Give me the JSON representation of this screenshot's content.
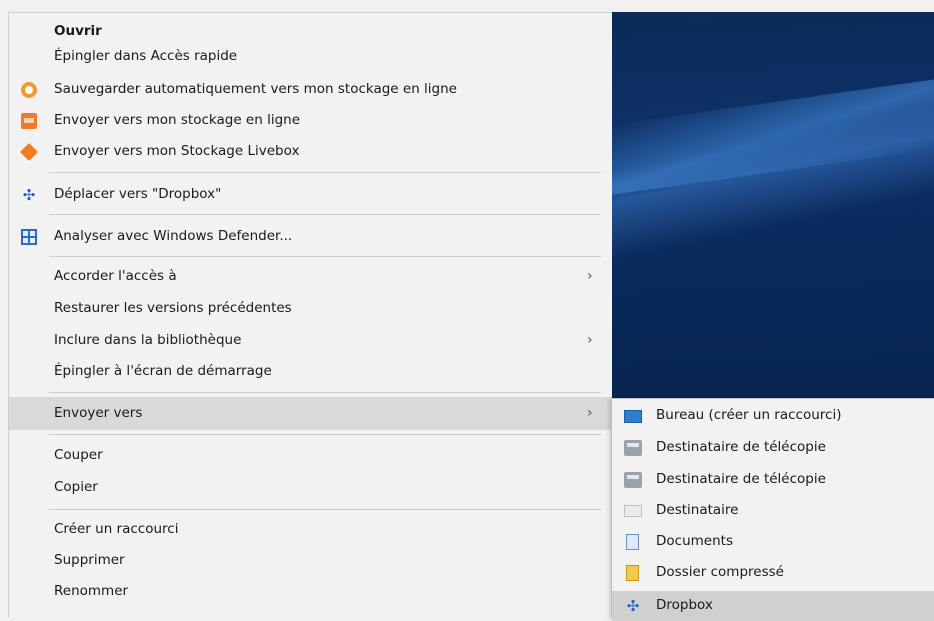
{
  "menu": {
    "items": [
      {
        "label": "Ouvrir",
        "icon": null
      },
      {
        "label": "Épingler dans Accès rapide",
        "icon": null
      },
      {
        "label": "Sauvegarder automatiquement vers mon stockage en ligne",
        "icon": "cloud-backup-icon"
      },
      {
        "label": "Envoyer vers mon stockage en ligne",
        "icon": "cloud-upload-icon"
      },
      {
        "label": "Envoyer vers mon Stockage Livebox",
        "icon": "livebox-icon"
      },
      {
        "label": "Déplacer vers \"Dropbox\"",
        "icon": "dropbox-icon"
      },
      {
        "label": "Analyser avec Windows Defender...",
        "icon": "windows-defender-icon"
      },
      {
        "label": "Accorder l'accès à",
        "icon": null
      },
      {
        "label": "Restaurer les versions précédentes",
        "icon": null
      },
      {
        "label": "Inclure dans la bibliothèque",
        "icon": null
      },
      {
        "label": "Épingler à l'écran de démarrage",
        "icon": null
      },
      {
        "label": "Envoyer vers",
        "icon": null
      },
      {
        "label": "Couper",
        "icon": null
      },
      {
        "label": "Copier",
        "icon": null
      },
      {
        "label": "Créer un raccourci",
        "icon": null
      },
      {
        "label": "Supprimer",
        "icon": null
      },
      {
        "label": "Renommer",
        "icon": null
      }
    ],
    "submenu_arrow": "›",
    "dropbox_glyph": "✣"
  },
  "submenu": {
    "items": [
      {
        "label": "Bureau (créer un raccourci)",
        "icon": "desktop-icon"
      },
      {
        "label": "Destinataire de télécopie",
        "icon": "fax-icon"
      },
      {
        "label": "Destinataire de télécopie",
        "icon": "fax-icon"
      },
      {
        "label": "Destinataire",
        "icon": "mail-recipient-icon"
      },
      {
        "label": "Documents",
        "icon": "documents-icon"
      },
      {
        "label": "Dossier compressé",
        "icon": "zip-folder-icon"
      },
      {
        "label": "Dropbox",
        "icon": "dropbox-icon"
      }
    ]
  },
  "colors": {
    "menu_bg": "#f2f2f2",
    "hover_bg": "#d9d9d9",
    "desktop_bg": "#0c2a57",
    "accent_orange": "#f29a2e",
    "dropbox_blue": "#1f63c9"
  }
}
